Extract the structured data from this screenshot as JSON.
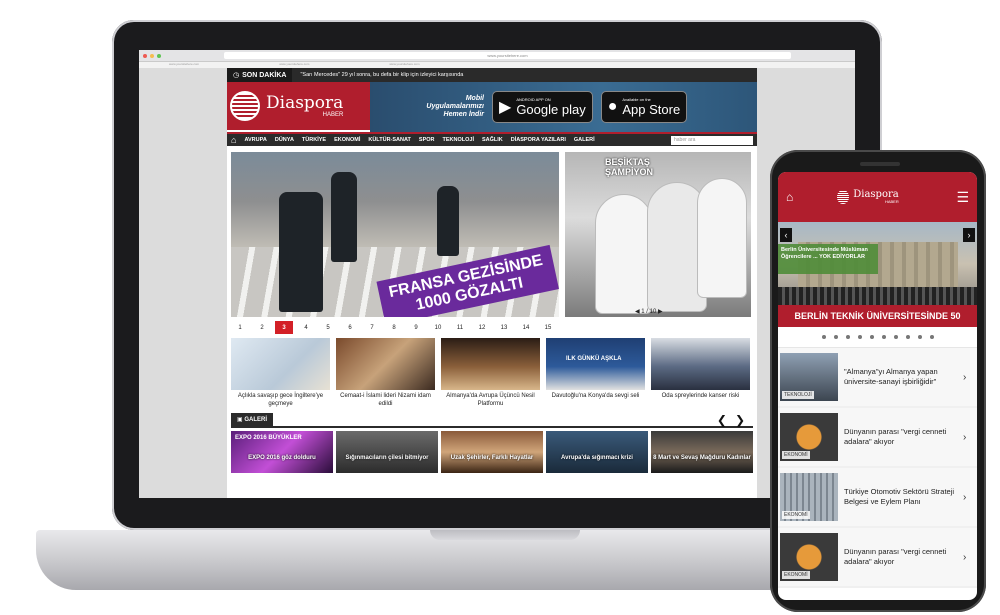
{
  "browser": {
    "url": "www.yoursitehere.com",
    "tab_left": "www.yoursitehere.com",
    "tab_mid": "www.yoursitehere.com",
    "tab_right": "www.yoursitehere.com"
  },
  "desktop": {
    "breaking": {
      "label": "SON DAKİKA",
      "text": "\"Sarı Mercedes\" 29 yıl sonra, bu defa bir klip için izleyici karşısında"
    },
    "logo": {
      "name": "Diaspora",
      "sub": "HABER"
    },
    "app_promo": {
      "line1": "Mobil",
      "line2": "Uygulamalarımızı",
      "line3": "Hemen İndir"
    },
    "google_play": {
      "small": "ANDROID APP ON",
      "big": "Google play"
    },
    "app_store": {
      "small": "Available on the",
      "big": "App Store"
    },
    "nav": [
      "AVRUPA",
      "DÜNYA",
      "TÜRKİYE",
      "EKONOMİ",
      "KÜLTÜR-SANAT",
      "SPOR",
      "TEKNOLOJİ",
      "SAĞLIK",
      "DİASPORA YAZILARI",
      "GALERİ"
    ],
    "search_placeholder": "haber ara",
    "hero_caption": {
      "line1": "FRANSA GEZİSİNDE",
      "line2": "1000 GÖZALTI"
    },
    "side_caption": {
      "line1": "BEŞİKTAŞ",
      "line2": "ŞAMPİYON"
    },
    "side_pager": "1 / 10",
    "pages": [
      "1",
      "2",
      "3",
      "4",
      "5",
      "6",
      "7",
      "8",
      "9",
      "10",
      "11",
      "12",
      "13",
      "14",
      "15"
    ],
    "active_page": "3",
    "thumbs": [
      {
        "caption": "Açlıkla savaşıp gece İngiltere'ye geçmeye"
      },
      {
        "caption": "Cemaat-i İslami lideri Nizami idam edildi"
      },
      {
        "caption": "Almanya'da Avrupa Üçüncü Nesil Platformu"
      },
      {
        "caption": "Davutoğlu'na Konya'da sevgi seli"
      },
      {
        "caption": "Oda spreylerinde kanser riski"
      }
    ],
    "thumb4_overlay": "ILK GÜNKÜ AŞKLA",
    "gallery_label": "GALERİ",
    "gallery": [
      {
        "caption": "EXPO 2016 göz dolduru"
      },
      {
        "caption": "Sığınmacıların çilesi bitmiyor"
      },
      {
        "caption": "Uzak Şehirler, Farklı Hayatlar"
      },
      {
        "caption": "Avrupa'da sığınmacı krizi"
      },
      {
        "caption": "8 Mart ve Sevaş Mağduru Kadınlar"
      }
    ],
    "gallery_expo_overlay": "EXPO 2016 BÜYÜKLER"
  },
  "phone": {
    "logo": {
      "name": "Diaspora",
      "sub": "HABER"
    },
    "hero_caption": "BERLİN TEKNİK ÜNİVERSİTESİNDE 50",
    "hero_overlay": "Berlin Üniversitesinde Müslüman Öğrencilere ... YOK EDİYORLAR",
    "items": [
      {
        "title": "\"Almanya\"yı Almanya yapan üniversite-sanayi işbirliğidir\"",
        "tag": "TEKNOLOJİ"
      },
      {
        "title": "Dünyanın parası \"vergi cenneti adalara\" akıyor",
        "tag": "EKONOMİ"
      },
      {
        "title": "Türkiye Otomotiv Sektörü Strateji Belgesi ve Eylem Planı",
        "tag": "EKONOMİ"
      },
      {
        "title": "Dünyanın parası \"vergi cenneti adalara\" akıyor",
        "tag": "EKONOMİ"
      }
    ]
  },
  "colors": {
    "brand_red": "#b01e2d",
    "nav_dark": "#2b2b2b",
    "page_active": "#d32027",
    "promo_purple": "#6a2a9c"
  }
}
